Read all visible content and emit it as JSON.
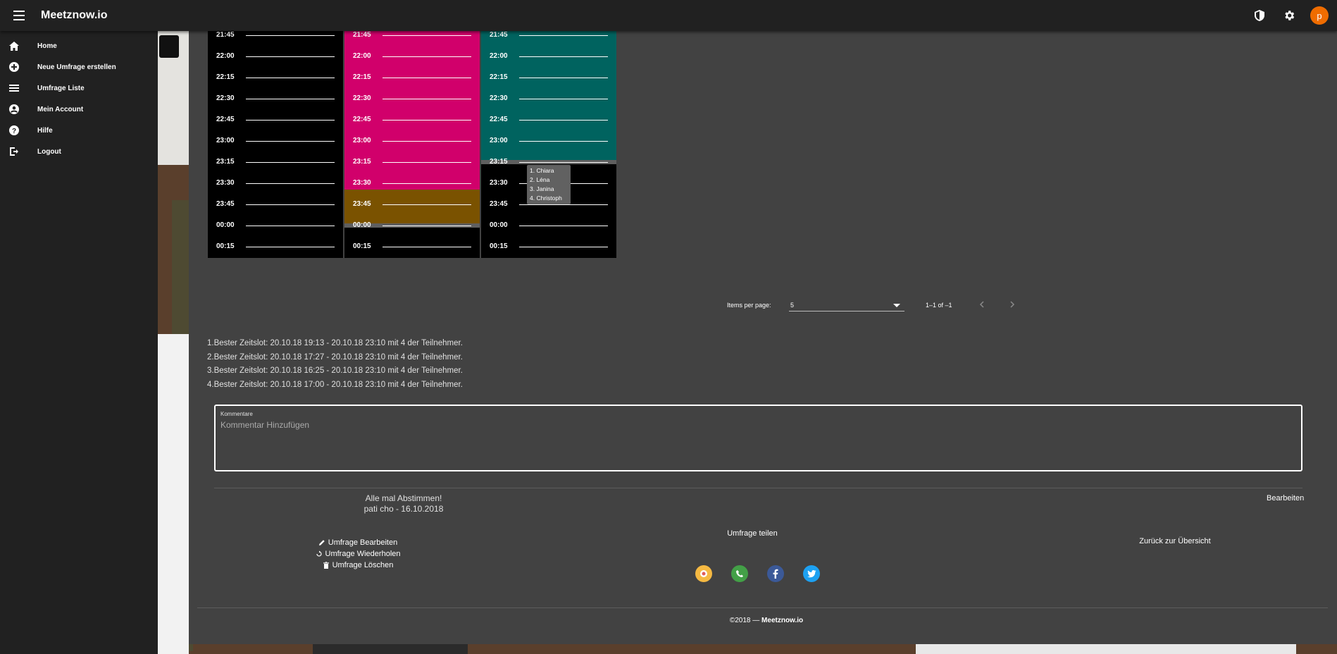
{
  "app": {
    "title": "Meetznow.io",
    "avatar_initial": "p"
  },
  "sidebar": {
    "items": [
      {
        "label": "Home",
        "icon": "home-icon"
      },
      {
        "label": "Neue Umfrage erstellen",
        "icon": "add-circle-icon"
      },
      {
        "label": "Umfrage Liste",
        "icon": "list-icon"
      },
      {
        "label": "Mein Account",
        "icon": "account-circle-icon"
      },
      {
        "label": "Hilfe",
        "icon": "help-icon"
      },
      {
        "label": "Logout",
        "icon": "logout-icon"
      }
    ]
  },
  "schedule": {
    "times": [
      "21:45",
      "22:00",
      "22:15",
      "22:30",
      "22:45",
      "23:00",
      "23:15",
      "23:30",
      "23:45",
      "00:00",
      "00:15"
    ],
    "colors": {
      "magenta": "#d1006b",
      "teal": "#00635f",
      "amber": "#7a5200",
      "grey": "#5f5f5f",
      "black": "#000000"
    },
    "tooltip": [
      "1. Chiara",
      "2. Léna",
      "3. Janina",
      "4. Christoph"
    ]
  },
  "paginator": {
    "items_per_page_label": "Items per page:",
    "page_size": "5",
    "range_label": "1–1 of –1"
  },
  "best_slots": [
    "1.Bester Zeitslot: 20.10.18 19:13 - 20.10.18 23:10 mit 4 der Teilnehmer.",
    "2.Bester Zeitslot: 20.10.18 17:27 - 20.10.18 23:10 mit 4 der Teilnehmer.",
    "3.Bester Zeitslot: 20.10.18 16:25 - 20.10.18 23:10 mit 4 der Teilnehmer.",
    "4.Bester Zeitslot: 20.10.18 17:00 - 20.10.18 23:10 mit 4 der Teilnehmer."
  ],
  "comments": {
    "label": "Kommentare",
    "placeholder": "Kommentar Hinzufügen"
  },
  "poll": {
    "title": "Alle mal Abstimmen!",
    "meta": "pati cho - 16.10.2018",
    "edit_label": "Bearbeiten"
  },
  "actions": {
    "edit": "Umfrage Bearbeiten",
    "repeat": "Umfrage Wiederholen",
    "delete": "Umfrage Löschen"
  },
  "share": {
    "title": "Umfrage teilen"
  },
  "back_label": "Zurück zur Übersicht",
  "footer": {
    "prefix": "©2018 — ",
    "brand": "Meetznow.io"
  }
}
